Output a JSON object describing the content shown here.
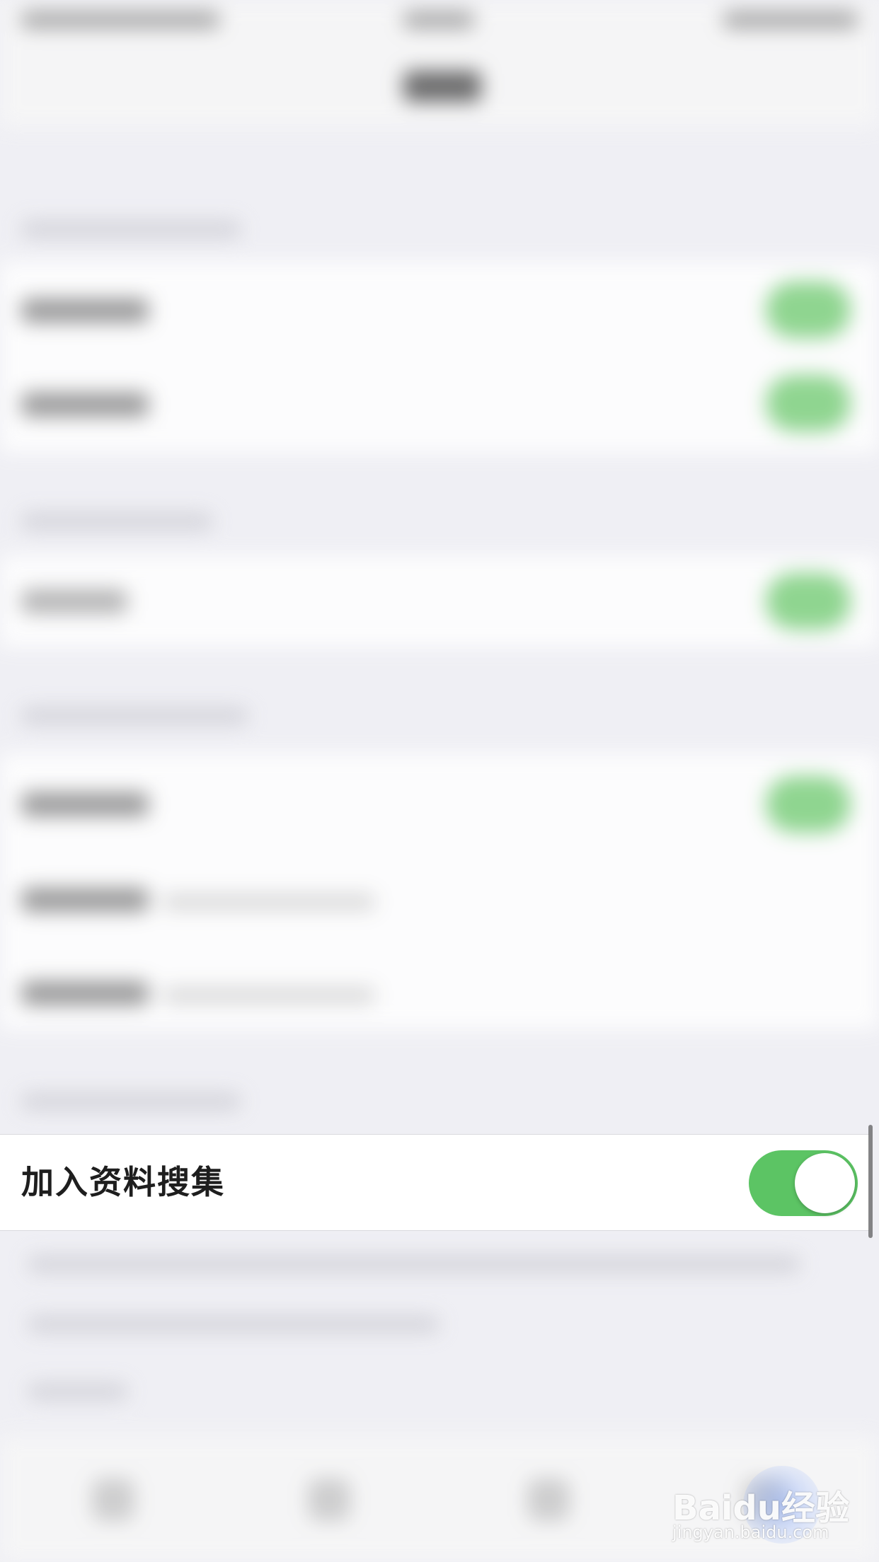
{
  "focused_row": {
    "label": "加入资料搜集",
    "toggle_on": true
  },
  "colors": {
    "toggle_on": "#5cc464",
    "background": "#efeff4",
    "row_background": "#ffffff"
  },
  "watermark": {
    "logo_text": "Baidu经验",
    "domain": "jingyan.baidu.com"
  }
}
